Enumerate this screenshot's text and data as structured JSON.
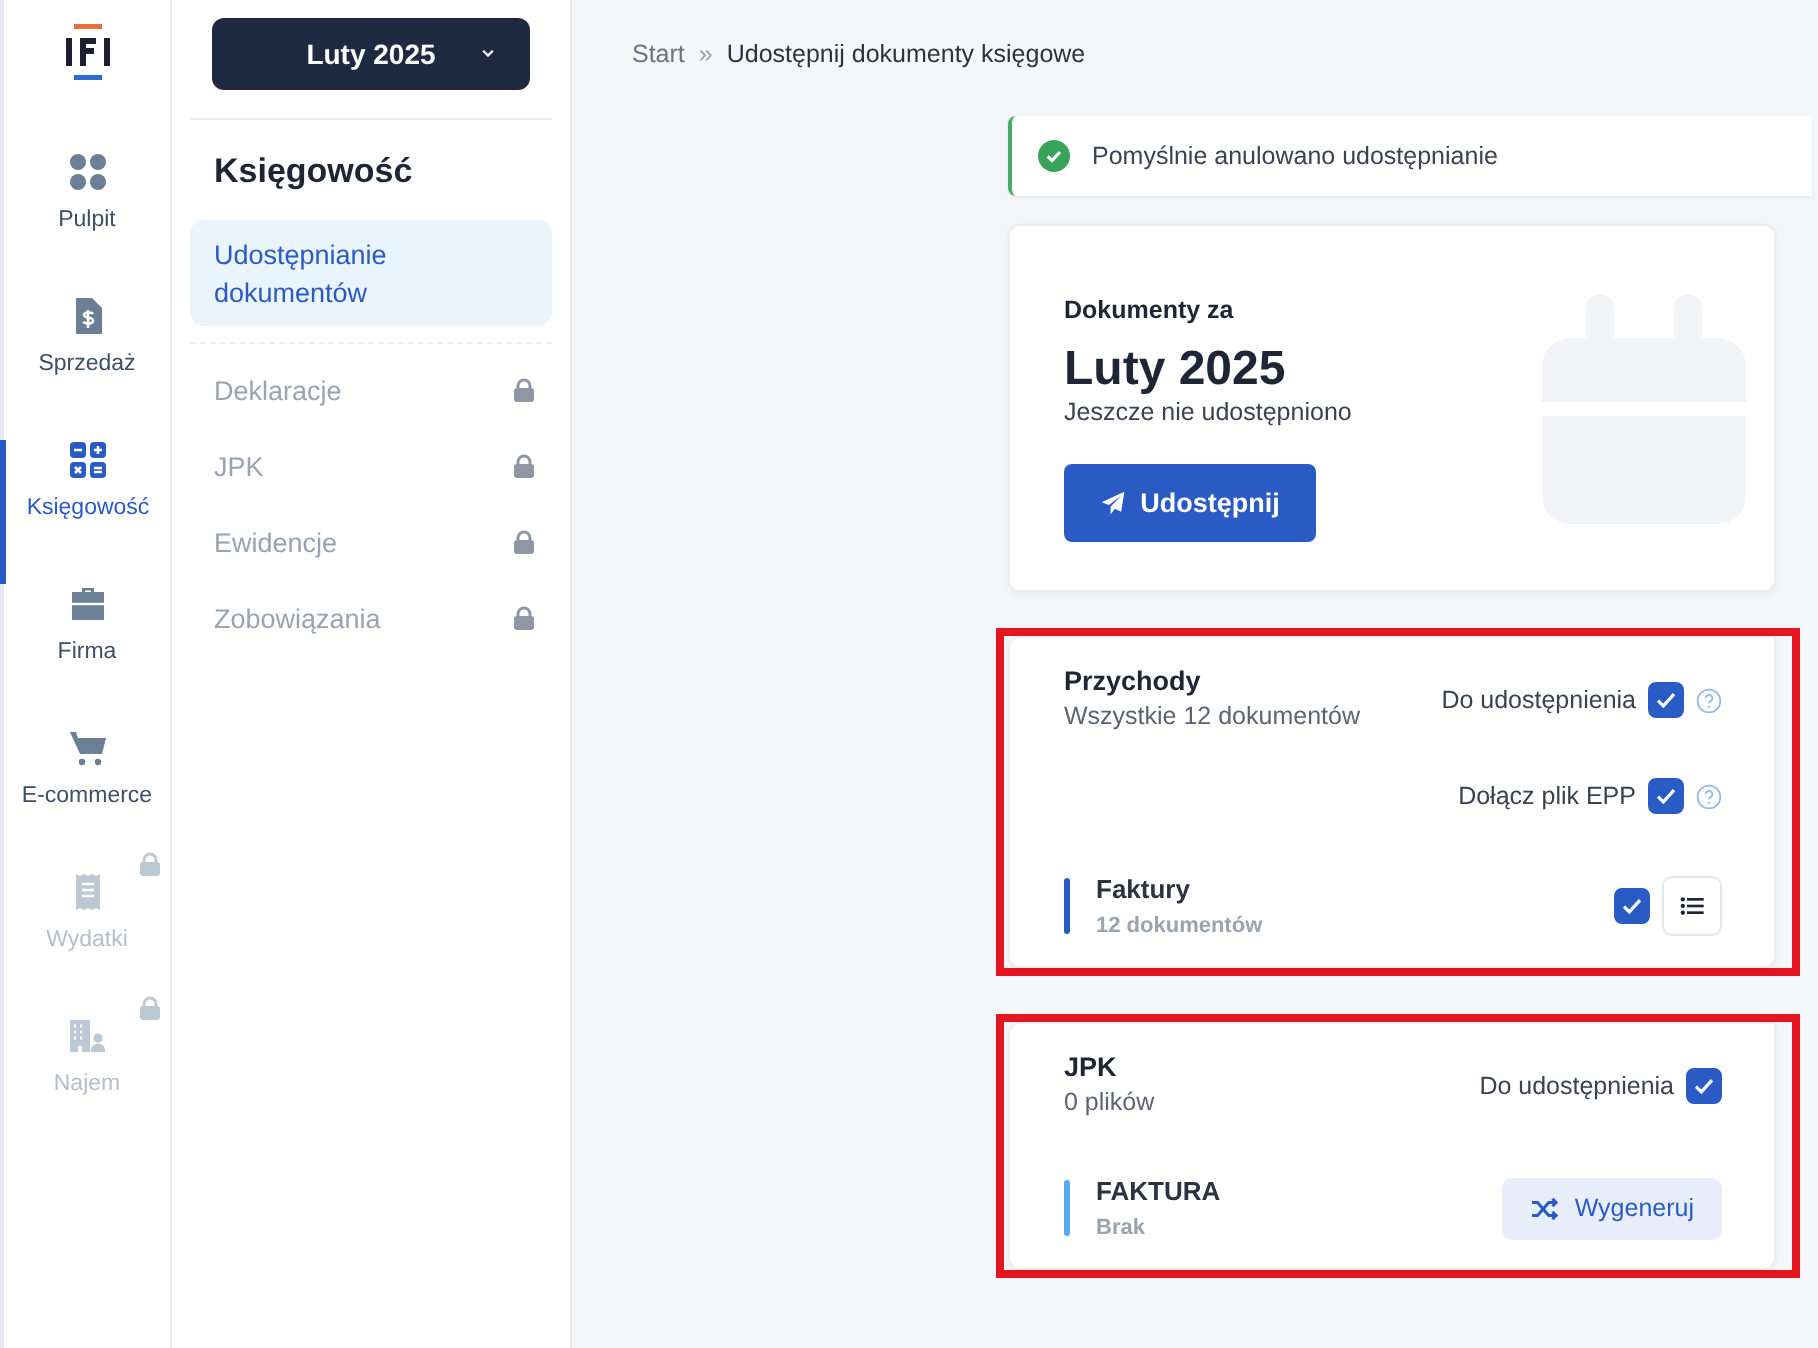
{
  "rail": [
    {
      "label": "Pulpit",
      "selected": false,
      "locked": false
    },
    {
      "label": "Sprzedaż",
      "selected": false,
      "locked": false
    },
    {
      "label": "Księgowość",
      "selected": true,
      "locked": false
    },
    {
      "label": "Firma",
      "selected": false,
      "locked": false
    },
    {
      "label": "E-commerce",
      "selected": false,
      "locked": false
    },
    {
      "label": "Wydatki",
      "selected": false,
      "locked": true
    },
    {
      "label": "Najem",
      "selected": false,
      "locked": true
    }
  ],
  "period_select": {
    "value": "Luty 2025"
  },
  "sidebar": {
    "title": "Księgowość",
    "items": [
      {
        "label": "Udostępnianie dokumentów",
        "selected": true,
        "locked": false
      },
      {
        "label": "Deklaracje",
        "selected": false,
        "locked": true
      },
      {
        "label": "JPK",
        "selected": false,
        "locked": true
      },
      {
        "label": "Ewidencje",
        "selected": false,
        "locked": true
      },
      {
        "label": "Zobowiązania",
        "selected": false,
        "locked": true
      }
    ]
  },
  "breadcrumb": [
    "Start",
    "Udostępnij dokumenty księgowe"
  ],
  "breadcrumb_separator": "»",
  "toast": {
    "message": "Pomyślnie anulowano udostępnianie"
  },
  "summary": {
    "caption": "Dokumenty za",
    "period": "Luty 2025",
    "status": "Jeszcze nie udostępniono",
    "button": "Udostępnij"
  },
  "sections": [
    {
      "title": "Przychody",
      "subtitle": "Wszystkie 12 dokumentów",
      "highlighted": true,
      "options": [
        {
          "label": "Do udostępnienia",
          "checked": true,
          "help": true
        },
        {
          "label": "Dołącz plik EPP",
          "checked": true,
          "help": true
        }
      ],
      "items": [
        {
          "kind": "list",
          "name": "Faktury",
          "detail": "12 dokumentów",
          "color": "#2a5bc4",
          "checked": true
        }
      ]
    },
    {
      "title": "JPK",
      "subtitle": "0 plików",
      "highlighted": true,
      "options": [
        {
          "label": "Do udostępnienia",
          "checked": true,
          "help": false
        }
      ],
      "items": [
        {
          "kind": "generate",
          "name": "FAKTURA",
          "detail": "Brak",
          "color": "#5aa8f0",
          "button": "Wygeneruj"
        }
      ]
    }
  ]
}
